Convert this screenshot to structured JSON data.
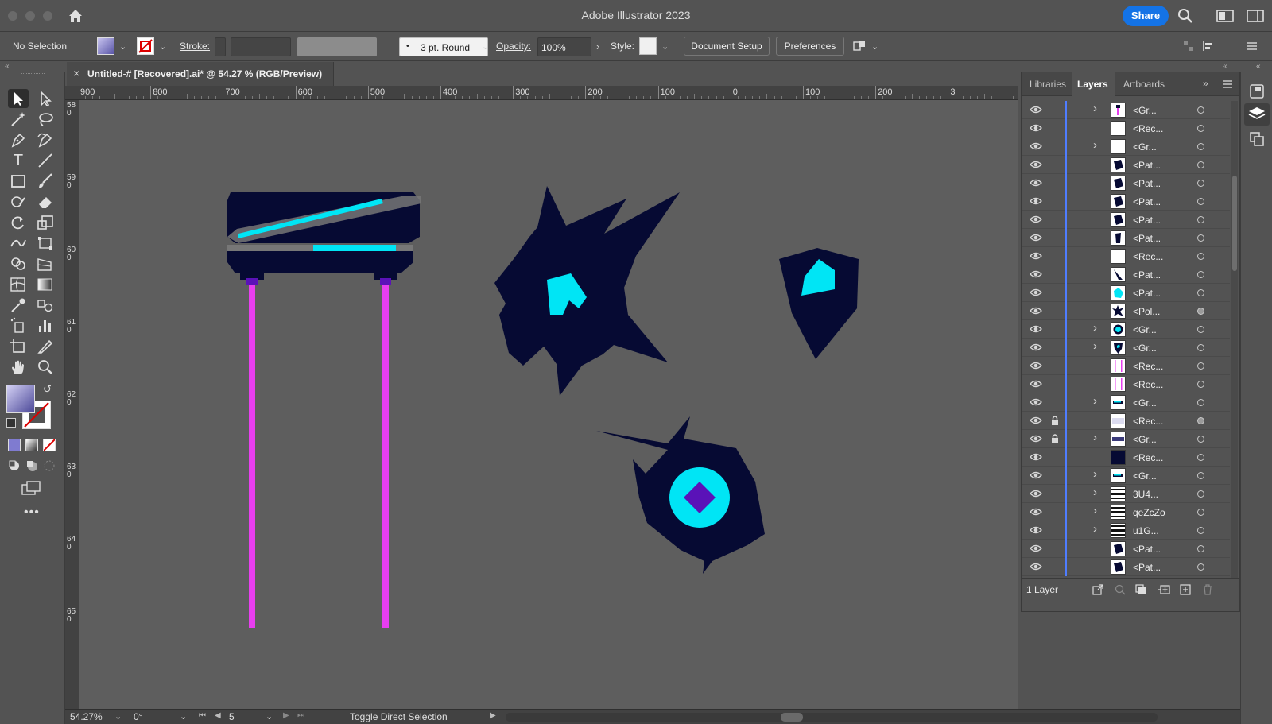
{
  "app": {
    "title": "Adobe Illustrator 2023",
    "share_label": "Share"
  },
  "control_bar": {
    "selection_label": "No Selection",
    "stroke_label": "Stroke:",
    "brush_value": "3 pt. Round",
    "opacity_label": "Opacity:",
    "opacity_value": "100%",
    "style_label": "Style:",
    "document_setup_label": "Document Setup",
    "preferences_label": "Preferences"
  },
  "document_tab": {
    "close_glyph": "×",
    "label": "Untitled-# [Recovered].ai* @ 54.27 % (RGB/Preview)"
  },
  "ruler": {
    "top_ticks": [
      "900",
      "800",
      "700",
      "600",
      "500",
      "400",
      "300",
      "200",
      "100",
      "0",
      "100",
      "200",
      "3"
    ],
    "left_ticks": [
      "580",
      "590",
      "600",
      "610",
      "620",
      "630",
      "640",
      "650"
    ]
  },
  "status_bar": {
    "zoom": "54.27%",
    "rotation": "0°",
    "artboard": "5",
    "tool_hint": "Toggle Direct Selection"
  },
  "panel": {
    "tabs": [
      {
        "label": "Libraries",
        "active": false
      },
      {
        "label": "Layers",
        "active": true
      },
      {
        "label": "Artboards",
        "active": false
      }
    ],
    "footer_label": "1 Layer",
    "layers": [
      {
        "name": "<Gr...",
        "expandable": true,
        "locked": false,
        "thumb": "figure",
        "target_filled": false
      },
      {
        "name": "<Rec...",
        "expandable": false,
        "locked": false,
        "thumb": "white",
        "target_filled": false
      },
      {
        "name": "<Gr...",
        "expandable": true,
        "locked": false,
        "thumb": "white",
        "target_filled": false
      },
      {
        "name": "<Pat...",
        "expandable": false,
        "locked": false,
        "thumb": "navy-poly",
        "target_filled": false
      },
      {
        "name": "<Pat...",
        "expandable": false,
        "locked": false,
        "thumb": "navy-poly",
        "target_filled": false
      },
      {
        "name": "<Pat...",
        "expandable": false,
        "locked": false,
        "thumb": "navy-poly",
        "target_filled": false
      },
      {
        "name": "<Pat...",
        "expandable": false,
        "locked": false,
        "thumb": "navy-poly",
        "target_filled": false
      },
      {
        "name": "<Pat...",
        "expandable": false,
        "locked": false,
        "thumb": "navy-sliver",
        "target_filled": false
      },
      {
        "name": "<Rec...",
        "expandable": false,
        "locked": false,
        "thumb": "white",
        "target_filled": false
      },
      {
        "name": "<Pat...",
        "expandable": false,
        "locked": false,
        "thumb": "navy-slash",
        "target_filled": false
      },
      {
        "name": "<Pat...",
        "expandable": false,
        "locked": false,
        "thumb": "cyan",
        "target_filled": false
      },
      {
        "name": "<Pol...",
        "expandable": false,
        "locked": false,
        "thumb": "navy-star",
        "target_filled": true
      },
      {
        "name": "<Gr...",
        "expandable": true,
        "locked": false,
        "thumb": "eye",
        "target_filled": false
      },
      {
        "name": "<Gr...",
        "expandable": true,
        "locked": false,
        "thumb": "shield",
        "target_filled": false
      },
      {
        "name": "<Rec...",
        "expandable": false,
        "locked": false,
        "thumb": "pink-lines",
        "target_filled": false
      },
      {
        "name": "<Rec...",
        "expandable": false,
        "locked": false,
        "thumb": "pink-lines",
        "target_filled": false
      },
      {
        "name": "<Gr...",
        "expandable": true,
        "locked": false,
        "thumb": "bench",
        "target_filled": false
      },
      {
        "name": "<Rec...",
        "expandable": false,
        "locked": true,
        "thumb": "light",
        "target_filled": true
      },
      {
        "name": "<Gr...",
        "expandable": true,
        "locked": true,
        "thumb": "dark-band",
        "target_filled": false
      },
      {
        "name": "<Rec...",
        "expandable": false,
        "locked": false,
        "thumb": "navy",
        "target_filled": false
      },
      {
        "name": "<Gr...",
        "expandable": true,
        "locked": false,
        "thumb": "bench",
        "target_filled": false
      },
      {
        "name": "3U4...",
        "expandable": true,
        "locked": false,
        "thumb": "stripes",
        "target_filled": false
      },
      {
        "name": "qeZcZo",
        "expandable": true,
        "locked": false,
        "thumb": "stripes",
        "target_filled": false
      },
      {
        "name": "u1G...",
        "expandable": true,
        "locked": false,
        "thumb": "stripes",
        "target_filled": false
      },
      {
        "name": "<Pat...",
        "expandable": false,
        "locked": false,
        "thumb": "navy-poly",
        "target_filled": false
      },
      {
        "name": "<Pat...",
        "expandable": false,
        "locked": false,
        "thumb": "navy-poly",
        "target_filled": false
      }
    ]
  },
  "colors": {
    "navy": "#060a33",
    "cyan": "#00e5f5",
    "magenta": "#e83ef0",
    "violet": "#5a12b8",
    "accent": "#1473e6"
  }
}
